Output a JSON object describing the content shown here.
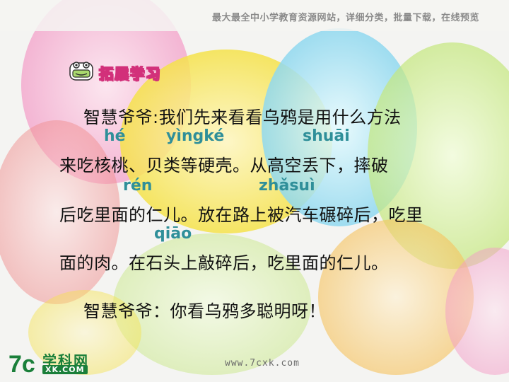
{
  "header": {
    "banner": "最大最全中小学教育资源网站，详细分类，批量下载，在线预览"
  },
  "section": {
    "title": "拓展学习",
    "icon": "frog-face-icon"
  },
  "passage": {
    "line1": "智慧爷爷:我们先来看看乌鸦是用什么方法",
    "pinyin1": [
      "hé",
      "yìngké",
      "shuāi"
    ],
    "line2": "来吃核桃、贝类等硬壳。从高空丢下，摔破",
    "pinyin2": [
      "rén",
      "zhǎsuì"
    ],
    "line3": "后吃里面的仁儿。放在路上被汽车碾碎后，吃里",
    "pinyin3": [
      "qiāo"
    ],
    "line4": "面的肉。在石头上敲碎后，吃里面的仁儿。",
    "line5": "智慧爷爷：你看乌鸦多聪明呀！"
  },
  "footer": {
    "url": "www.7cxk.com",
    "logo_mark": "7c",
    "logo_title": "学科网",
    "logo_sub": "XK.COM"
  },
  "colors": {
    "pinyin": "#2f8f99",
    "title_outline": "#d2307a",
    "logo": "#1a7f3a"
  }
}
